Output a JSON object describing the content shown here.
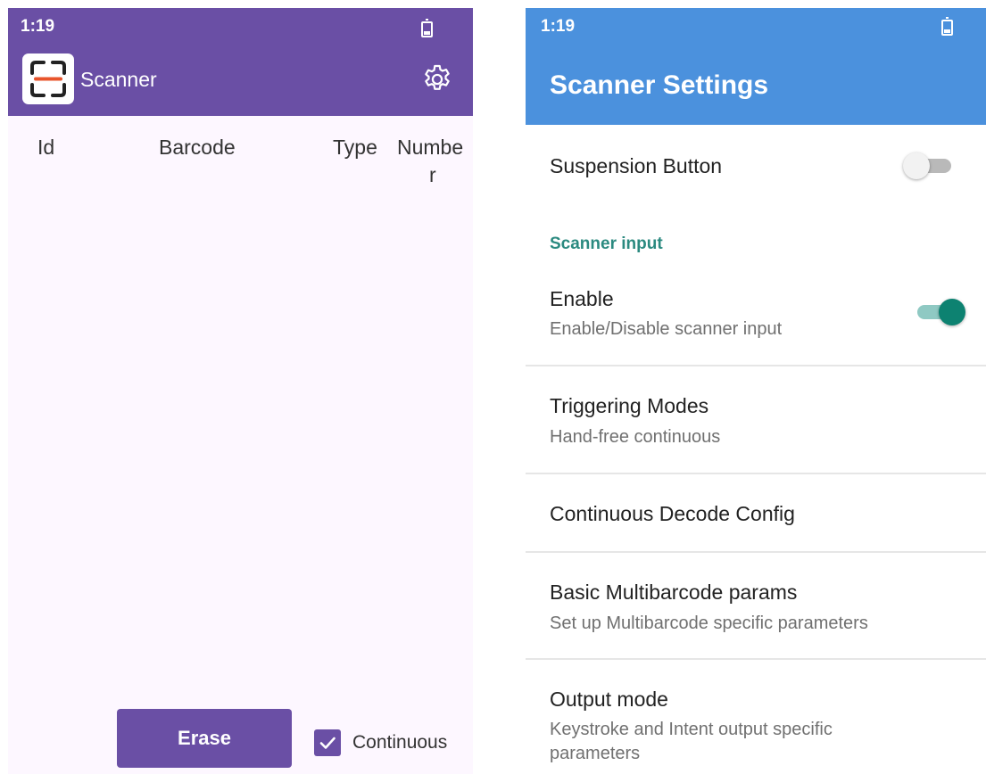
{
  "left_app": {
    "status_time": "1:19",
    "title": "Scanner",
    "logo_icon": "scanner-frame-icon",
    "settings_icon": "gear-icon",
    "columns": [
      "Id",
      "Barcode",
      "Type",
      "Numbe",
      "r"
    ],
    "erase_label": "Erase",
    "continuous_label": "Continuous",
    "continuous_checked": true,
    "colors": {
      "app_bar": "#6a4fa5",
      "background": "#fdf7ff",
      "logo_accent": "#e8542c"
    }
  },
  "right_app": {
    "status_time": "1:19",
    "title": "Scanner Settings",
    "suspension": {
      "title": "Suspension Button",
      "enabled": false
    },
    "category": "Scanner input",
    "prefs": [
      {
        "title": "Enable",
        "summary": "Enable/Disable scanner input",
        "enabled": true
      },
      {
        "title": "Triggering Modes",
        "summary": "Hand-free continuous"
      },
      {
        "title": "Continuous Decode Config"
      },
      {
        "title": "Basic Multibarcode params",
        "summary": "Set up Multibarcode specific parameters"
      },
      {
        "title": "Output mode",
        "summary_line1": "Keystroke and Intent output specific",
        "summary_line2": "parameters"
      }
    ],
    "colors": {
      "app_bar": "#4b91dd",
      "accent": "#2b8a80"
    }
  }
}
